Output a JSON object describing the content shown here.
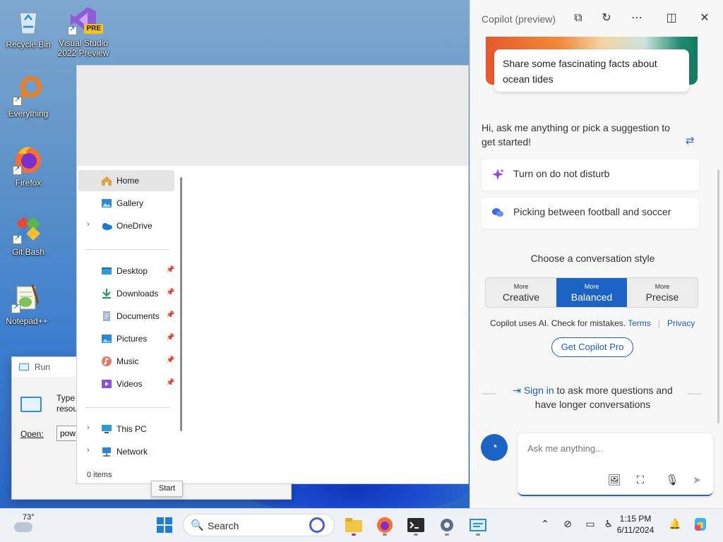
{
  "desktop": {
    "icons": [
      {
        "label": "Recycle Bin",
        "icon": "recycle-bin-icon"
      },
      {
        "label": "Visual Studio 2022 Preview",
        "badge": "PRE",
        "icon": "visual-studio-icon"
      },
      {
        "label": "Everything",
        "icon": "everything-search-icon"
      },
      {
        "label": "Firefox",
        "icon": "firefox-icon"
      },
      {
        "label": "Git Bash",
        "icon": "git-bash-icon"
      },
      {
        "label": "Notepad++",
        "icon": "notepad-plus-plus-icon"
      }
    ]
  },
  "run_dialog": {
    "title": "Run",
    "description_line1": "Type",
    "description_line2": "resou",
    "open_label": "Open:",
    "open_value": "pow"
  },
  "explorer": {
    "nav": {
      "home": "Home",
      "gallery": "Gallery",
      "onedrive": "OneDrive",
      "desktop": "Desktop",
      "downloads": "Downloads",
      "documents": "Documents",
      "pictures": "Pictures",
      "music": "Music",
      "videos": "Videos",
      "this_pc": "This PC",
      "network": "Network"
    },
    "status": "0 items",
    "tooltip": "Start"
  },
  "copilot": {
    "title": "Copilot (preview)",
    "card_prompt": "Share some fascinating facts about ocean tides",
    "greeting": "Hi, ask me anything or pick a suggestion to get started!",
    "suggestions": [
      "Turn on do not disturb",
      "Picking between football and soccer"
    ],
    "style_title": "Choose a conversation style",
    "styles": [
      {
        "small": "More",
        "big": "Creative"
      },
      {
        "small": "More",
        "big": "Balanced"
      },
      {
        "small": "More",
        "big": "Precise"
      }
    ],
    "active_style": "Balanced",
    "disclaimer": "Copilot uses AI. Check for mistakes.",
    "terms": "Terms",
    "privacy": "Privacy",
    "pro_button": "Get Copilot Pro",
    "signin_link": "Sign in",
    "signin_text": " to ask more questions and",
    "signin_text2": "have longer conversations",
    "input_placeholder": "Ask me anything...",
    "accent": "#1b63c4"
  },
  "taskbar": {
    "weather_temp": "73°",
    "search_label": "Search",
    "time": "1:15 PM",
    "date": "6/11/2024"
  }
}
